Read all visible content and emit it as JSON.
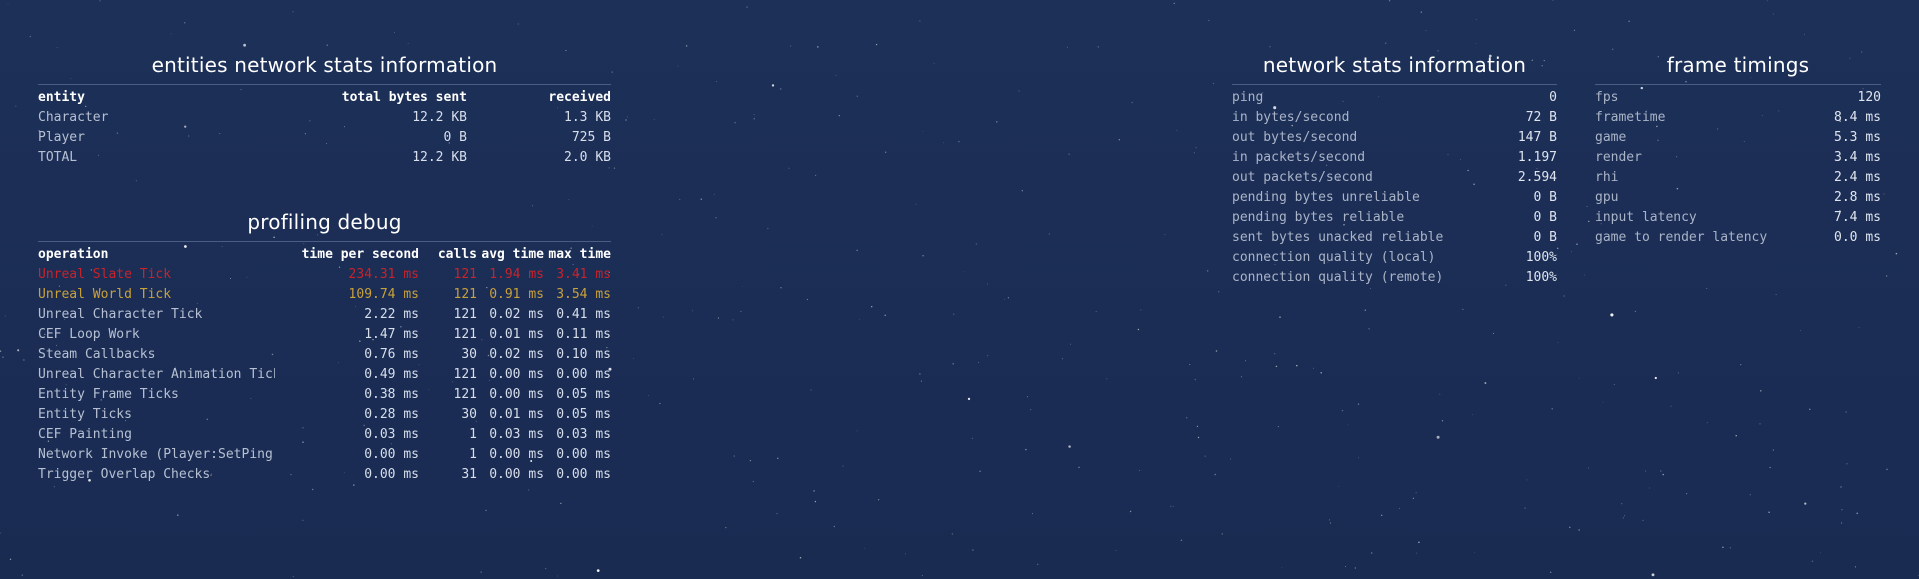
{
  "entities_panel": {
    "title": "entities network stats information",
    "headers": [
      "entity",
      "total bytes sent",
      "received"
    ],
    "rows": [
      [
        "Character",
        "12.2 KB",
        "1.3 KB"
      ],
      [
        "Player",
        "0 B",
        "725 B"
      ],
      [
        "TOTAL",
        "12.2 KB",
        "2.0 KB"
      ]
    ]
  },
  "profiling_panel": {
    "title": "profiling debug",
    "headers": [
      "operation",
      "time per second",
      "calls",
      "avg time",
      "max time"
    ],
    "rows": [
      [
        "Unreal Slate Tick",
        "234.31 ms",
        "121",
        "1.94 ms",
        "3.41 ms"
      ],
      [
        "Unreal World Tick",
        "109.74 ms",
        "121",
        "0.91 ms",
        "3.54 ms"
      ],
      [
        "Unreal Character Tick",
        "2.22 ms",
        "121",
        "0.02 ms",
        "0.41 ms"
      ],
      [
        "CEF Loop Work",
        "1.47 ms",
        "121",
        "0.01 ms",
        "0.11 ms"
      ],
      [
        "Steam Callbacks",
        "0.76 ms",
        "30",
        "0.02 ms",
        "0.10 ms"
      ],
      [
        "Unreal Character Animation Tick",
        "0.49 ms",
        "121",
        "0.00 ms",
        "0.00 ms"
      ],
      [
        "Entity Frame Ticks",
        "0.38 ms",
        "121",
        "0.00 ms",
        "0.05 ms"
      ],
      [
        "Entity Ticks",
        "0.28 ms",
        "30",
        "0.01 ms",
        "0.05 ms"
      ],
      [
        "CEF Painting",
        "0.03 ms",
        "1",
        "0.03 ms",
        "0.03 ms"
      ],
      [
        "Network Invoke (Player:SetPing)",
        "0.00 ms",
        "1",
        "0.00 ms",
        "0.00 ms"
      ],
      [
        "Trigger Overlap Checks",
        "0.00 ms",
        "31",
        "0.00 ms",
        "0.00 ms"
      ]
    ],
    "highlight_colors": {
      "critical": "#c8232b",
      "warning": "#c9a13a"
    }
  },
  "network_panel": {
    "title": "network stats information",
    "rows": [
      [
        "ping",
        "0"
      ],
      [
        "in bytes/second",
        "72 B"
      ],
      [
        "out bytes/second",
        "147 B"
      ],
      [
        "in packets/second",
        "1.197"
      ],
      [
        "out packets/second",
        "2.594"
      ],
      [
        "pending bytes unreliable",
        "0 B"
      ],
      [
        "pending bytes reliable",
        "0 B"
      ],
      [
        "sent bytes unacked reliable",
        "0 B"
      ],
      [
        "connection quality (local)",
        "100%"
      ],
      [
        "connection quality (remote)",
        "100%"
      ]
    ]
  },
  "frame_panel": {
    "title": "frame timings",
    "rows": [
      [
        "fps",
        "120"
      ],
      [
        "frametime",
        "8.4 ms"
      ],
      [
        "game",
        "5.3 ms"
      ],
      [
        "render",
        "3.4 ms"
      ],
      [
        "rhi",
        "2.4 ms"
      ],
      [
        "gpu",
        "2.8 ms"
      ],
      [
        "input latency",
        "7.4 ms"
      ],
      [
        "game to render latency",
        "0.0 ms"
      ]
    ]
  }
}
